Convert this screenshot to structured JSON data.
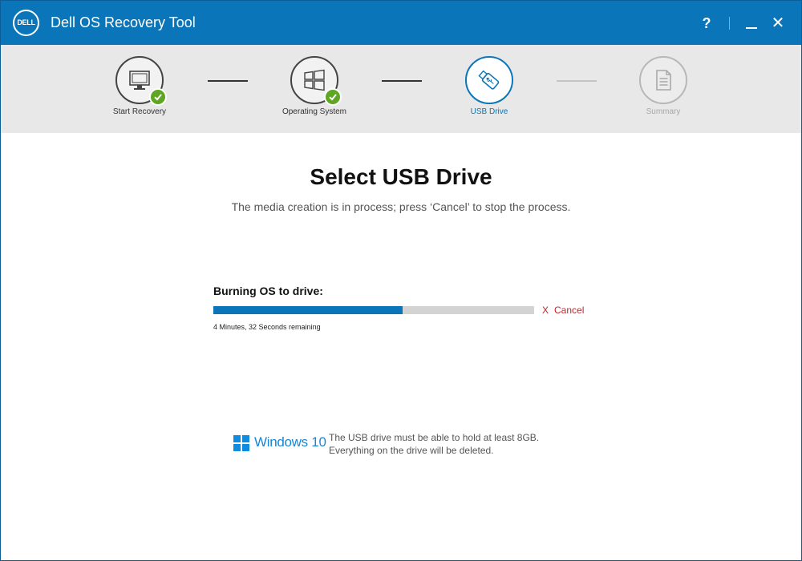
{
  "titlebar": {
    "logo_text": "DELL",
    "title": "Dell OS Recovery Tool",
    "help_label": "?",
    "close_label": "✕"
  },
  "steps": [
    {
      "label": "Start Recovery",
      "state": "complete",
      "icon": "monitor-icon"
    },
    {
      "label": "Operating System",
      "state": "complete",
      "icon": "windows-icon"
    },
    {
      "label": "USB Drive",
      "state": "active",
      "icon": "usb-icon"
    },
    {
      "label": "Summary",
      "state": "pending",
      "icon": "document-icon"
    }
  ],
  "main": {
    "heading": "Select USB Drive",
    "subheading": "The media creation is in process; press ‘Cancel’ to stop the process.",
    "progress": {
      "label": "Burning OS to drive:",
      "percent": 59,
      "remaining": "4 Minutes, 32 Seconds remaining",
      "cancel_icon": "X",
      "cancel_label": "Cancel"
    },
    "footer_note": {
      "brand": "Windows 10",
      "line1": "The USB drive must be able to hold at least 8GB.",
      "line2": "Everything on the drive will be deleted."
    }
  },
  "colors": {
    "accent": "#0b75b9",
    "success": "#5ea623",
    "danger": "#c0272d",
    "windows_blue": "#0d8ce0"
  }
}
